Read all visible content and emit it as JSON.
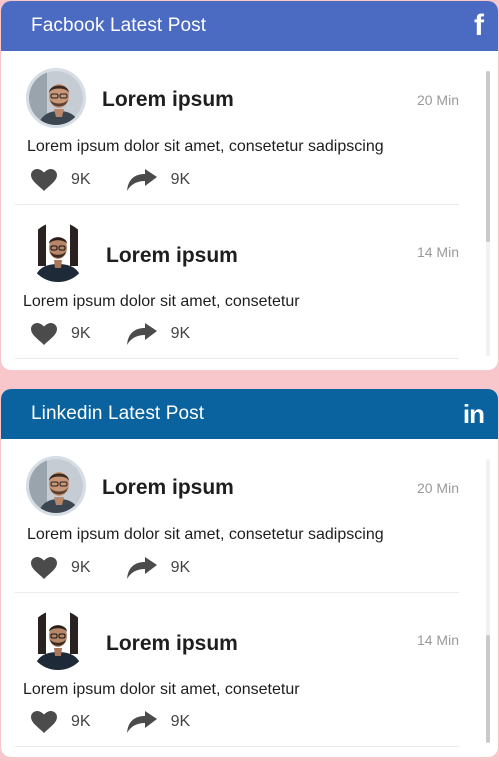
{
  "cards": [
    {
      "title": "Facbook Latest Post",
      "brand_icon": "f",
      "header_color": "#4a6bc1",
      "posts": [
        {
          "author": "Lorem ipsum",
          "time": "20 Min",
          "text": "Lorem ipsum dolor sit amet, consetetur sadipscing",
          "likes": "9K",
          "shares": "9K"
        },
        {
          "author": "Lorem ipsum",
          "time": "14 Min",
          "text": "Lorem ipsum dolor sit amet, consetetur",
          "likes": "9K",
          "shares": "9K"
        }
      ]
    },
    {
      "title": "Linkedin Latest Post",
      "brand_icon": "in",
      "header_color": "#0a639f",
      "posts": [
        {
          "author": "Lorem ipsum",
          "time": "20 Min",
          "text": "Lorem ipsum dolor sit amet, consetetur sadipscing",
          "likes": "9K",
          "shares": "9K"
        },
        {
          "author": "Lorem ipsum",
          "time": "14 Min",
          "text": "Lorem ipsum dolor sit amet, consetetur",
          "likes": "9K",
          "shares": "9K"
        }
      ]
    }
  ],
  "icons": {
    "like": "heart-icon",
    "share": "share-arrow-icon"
  },
  "colors": {
    "page_background": "#f7c7cc",
    "facebook": "#4a6bc1",
    "linkedin": "#0a639f"
  }
}
